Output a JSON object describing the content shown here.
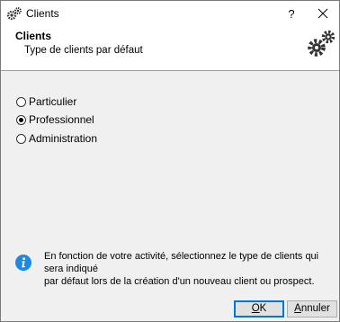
{
  "window": {
    "title": "Clients",
    "help_label": "?",
    "icon": "gear-icon",
    "close_icon": "close-icon"
  },
  "header": {
    "title": "Clients",
    "subtitle": "Type de clients par défaut",
    "icon": "gears-icon"
  },
  "client_types": [
    {
      "label": "Particulier",
      "checked": false
    },
    {
      "label": "Professionnel",
      "checked": true
    },
    {
      "label": "Administration",
      "checked": false
    }
  ],
  "info": {
    "icon": "info-icon",
    "line1": "En fonction de votre activité, sélectionnez le type de clients qui sera indiqué",
    "line2": "par défaut lors de la création d'un nouveau client ou prospect."
  },
  "buttons": {
    "ok_accel": "O",
    "ok_rest": "K",
    "cancel_accel": "A",
    "cancel_rest": "nnuler"
  },
  "colors": {
    "accent": "#0078d7",
    "info_blue": "#1e88e5",
    "gear": "#333333"
  }
}
